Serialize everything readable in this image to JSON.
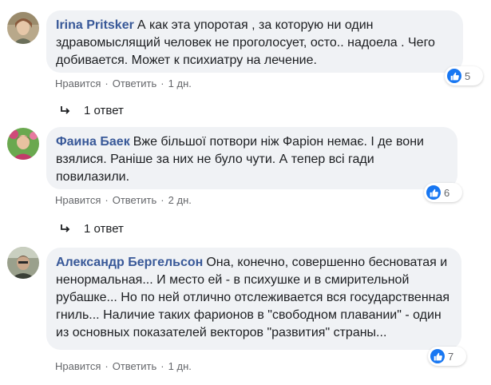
{
  "comments": [
    {
      "author": "Irina Pritsker",
      "text": "А как эта упоротая , за которую ни один здравомыслящий человек не проголосует, осто.. надоела . Чего добивается. Может к психиатру на лечение.",
      "likes": "5",
      "like_label": "Нравится",
      "reply_label": "Ответить",
      "time": "1 дн.",
      "replies": "1 ответ"
    },
    {
      "author": "Фаина Баек",
      "text": "Вже більшої потвори ніж Фаріон немає. І де вони взялися. Раніше за них не було чути. А тепер всі гади повилазили.",
      "likes": "6",
      "like_label": "Нравится",
      "reply_label": "Ответить",
      "time": "2 дн.",
      "replies": "1 ответ"
    },
    {
      "author": "Александр Бергельсон",
      "text": "Она, конечно, совершенно бесноватая и ненормальная... И место ей - в психушке и в смирительной рубашке... Но по ней отлично отслеживается вся государственная гниль... Наличие таких фарионов в \"свободном плавании\" - один из основных показателей векторов \"развития\" страны...",
      "likes": "7",
      "like_label": "Нравится",
      "reply_label": "Ответить",
      "time": "1 дн."
    }
  ],
  "separator": "·",
  "icons": {
    "reaction": "like-thumb-icon",
    "replies": "reply-arrow-icon"
  },
  "colors": {
    "author": "#385898",
    "bubble": "#f0f2f5",
    "like": "#1877f2",
    "meta": "#65676b"
  }
}
